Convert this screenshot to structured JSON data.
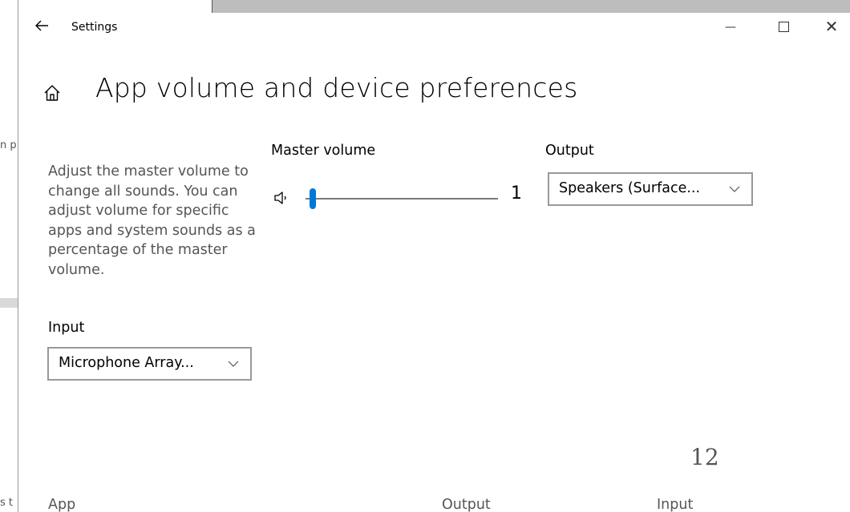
{
  "window": {
    "title": "Settings",
    "back_icon": "back-arrow-icon",
    "minimize_glyph": "—",
    "close_glyph": "✕"
  },
  "page": {
    "title": "App volume and device preferences",
    "home_icon": "home-icon",
    "description": "Adjust the master volume to change all sounds. You can adjust volume for specific apps and system sounds as a percentage of the master volume."
  },
  "master_volume": {
    "label": "Master volume",
    "value": "1",
    "level_percent": 1
  },
  "output": {
    "label": "Output",
    "selected": "Speakers (Surface..."
  },
  "input": {
    "label": "Input",
    "selected": "Microphone Array..."
  },
  "overlay": {
    "page_number": "12"
  },
  "app_table": {
    "columns": [
      "App",
      "Output",
      "Input"
    ]
  },
  "background": {
    "fragment_1": "n p",
    "fragment_2": "s t"
  },
  "colors": {
    "accent": "#0078d7"
  }
}
